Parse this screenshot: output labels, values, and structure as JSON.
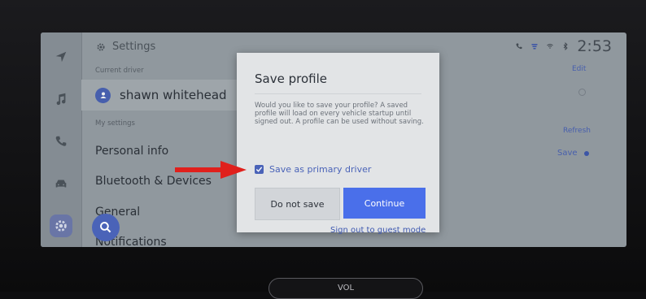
{
  "header": {
    "title": "Settings",
    "icon": "gear-icon"
  },
  "status": {
    "time": "2:53",
    "icons": [
      "phone-icon",
      "bluetooth-audio-icon",
      "wifi-signal-icon",
      "bluetooth-icon"
    ]
  },
  "rail": {
    "items": [
      "navigation-icon",
      "music-icon",
      "phone-icon",
      "car-icon",
      "settings-icon"
    ],
    "active": "settings-icon"
  },
  "sections": {
    "current_driver": "Current driver",
    "my_settings": "My settings"
  },
  "driver": {
    "name": "shawn whitehead"
  },
  "menu": [
    "Personal info",
    "Bluetooth & Devices",
    "General",
    "Notifications"
  ],
  "right_column": {
    "edit": "Edit",
    "refresh": "Refresh",
    "save": "Save",
    "sign_out": "Sign out to guest mode"
  },
  "dialog": {
    "title": "Save profile",
    "body": "Would you like to save your profile? A saved profile will load on every vehicle startup until signed out. A profile can be used without saving.",
    "checkbox_label": "Save as primary driver",
    "checkbox_checked": true,
    "secondary_button": "Do not save",
    "primary_button": "Continue"
  },
  "annotation": {
    "arrow_color": "#e0201c"
  },
  "knob": {
    "labels": [
      "VOL"
    ]
  },
  "colors": {
    "accent": "#4a63b8",
    "primary_button": "#4a6fea"
  }
}
